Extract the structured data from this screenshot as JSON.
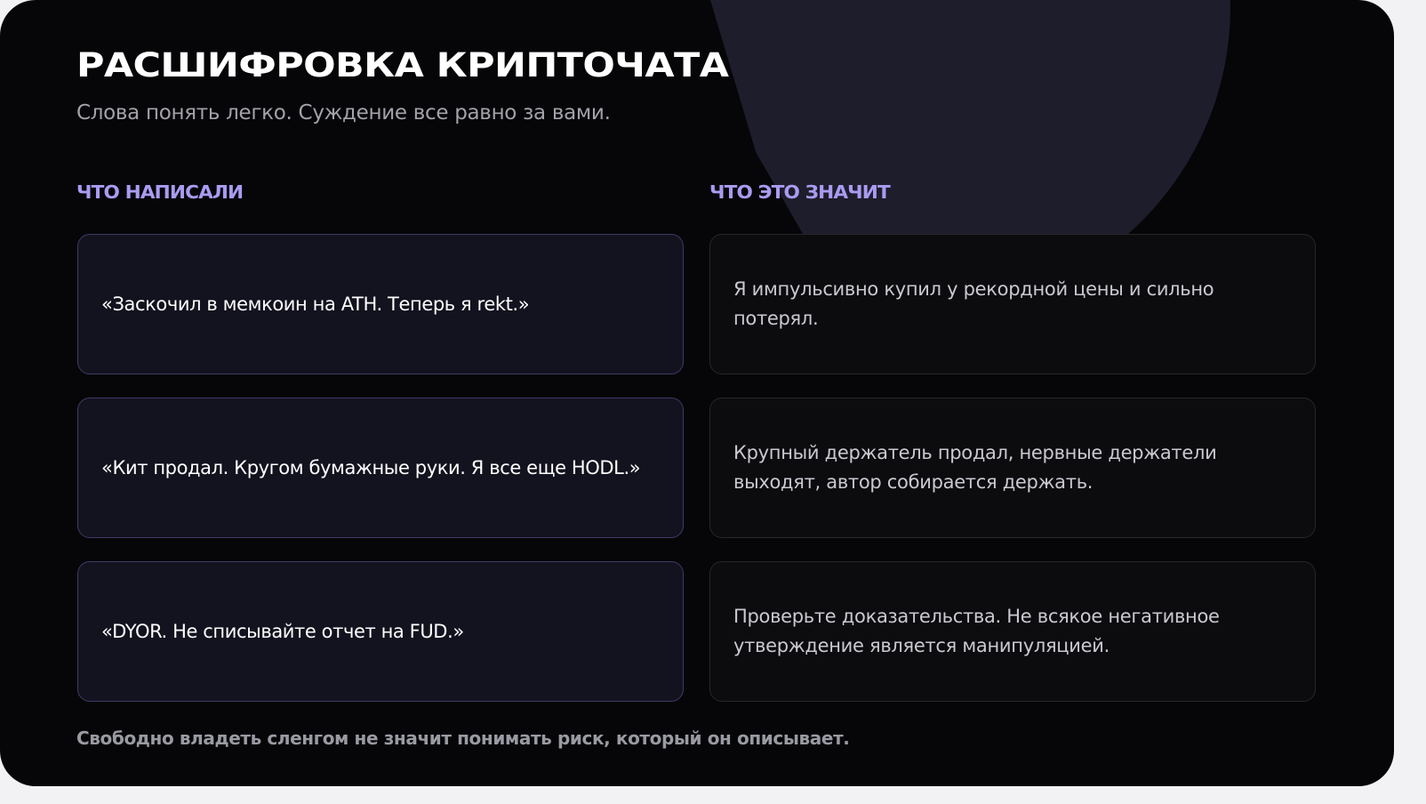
{
  "header": {
    "title": "РАСШИФРОВКА КРИПТОЧАТА",
    "subtitle": "Слова понять легко. Суждение все равно за вами."
  },
  "columns": {
    "left_heading": "ЧТО НАПИСАЛИ",
    "right_heading": "ЧТО ЭТО ЗНАЧИТ"
  },
  "rows": [
    {
      "phrase": "«Заскочил в мемкоин на ATH. Теперь я rekt.»",
      "meaning": "Я импульсивно купил у рекордной цены и сильно потерял."
    },
    {
      "phrase": "«Кит продал. Кругом бумажные руки. Я все еще HODL.»",
      "meaning": "Крупный держатель продал, нервные держатели выходят, автор собирается держать."
    },
    {
      "phrase": "«DYOR. Не списывайте отчет на FUD.»",
      "meaning": "Проверьте доказательства. Не всякое негативное утверждение является манипуляцией."
    }
  ],
  "footer": {
    "note": "Свободно владеть сленгом не значит понимать риск, который он описывает."
  },
  "colors": {
    "background": "#060608",
    "accent": "#a99bf2",
    "phrase_card": "#13121f",
    "phrase_border": "#3f3a66",
    "meaning_card": "#0c0c0f",
    "decor_shape": "#1e1d2b"
  }
}
